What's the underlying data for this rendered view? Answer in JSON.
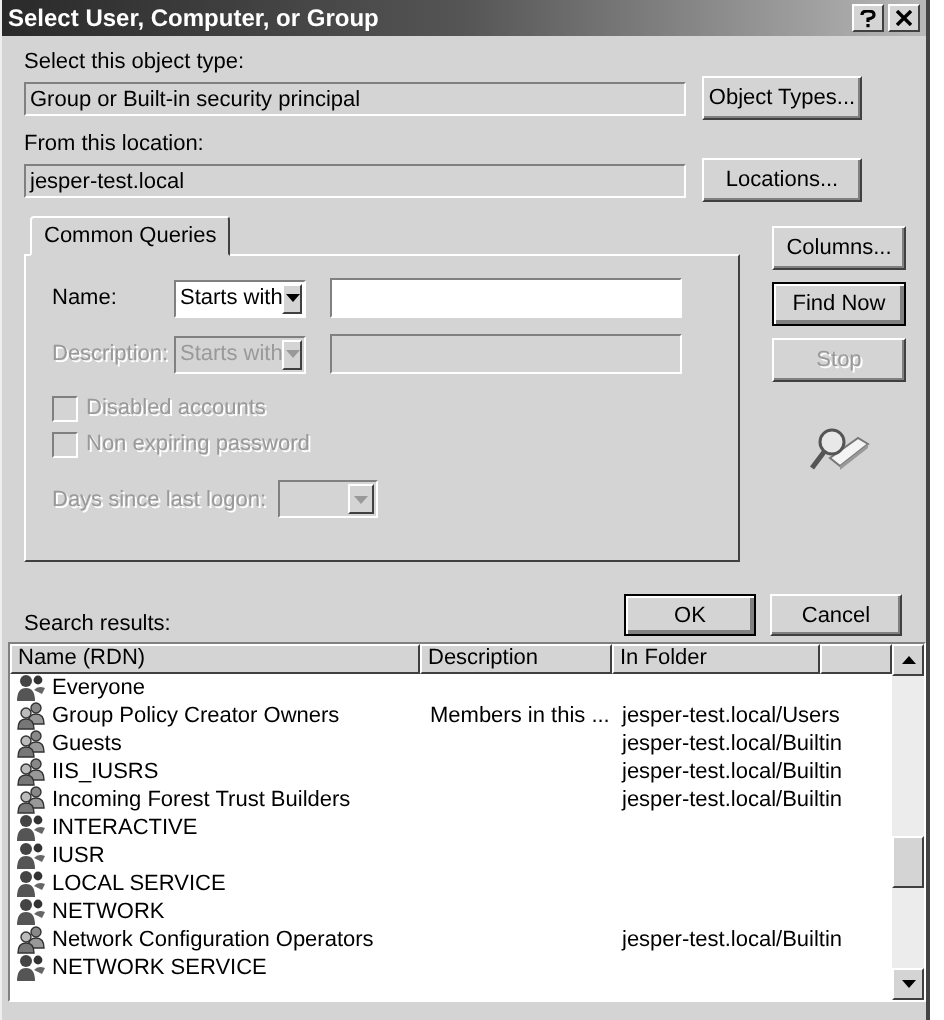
{
  "window": {
    "title": "Select User, Computer, or Group"
  },
  "object_type": {
    "label": "Select this object type:",
    "value": "Group or Built-in security principal",
    "button": "Object Types..."
  },
  "location": {
    "label": "From this location:",
    "value": "jesper-test.local",
    "button": "Locations..."
  },
  "tabs": [
    {
      "label": "Common Queries",
      "selected": true
    }
  ],
  "query": {
    "name": {
      "label": "Name:",
      "mode": "Starts with",
      "disabled": false
    },
    "description": {
      "label": "Description:",
      "mode": "Starts with",
      "disabled": true
    },
    "options": [
      {
        "label": "Disabled accounts",
        "checked": false,
        "disabled": true
      },
      {
        "label": "Non expiring password",
        "checked": false,
        "disabled": true
      }
    ],
    "days": {
      "label": "Days since last logon:",
      "disabled": true
    }
  },
  "side_buttons": [
    {
      "label": "Columns...",
      "disabled": false,
      "default": false
    },
    {
      "label": "Find Now",
      "disabled": false,
      "default": true
    },
    {
      "label": "Stop",
      "disabled": true,
      "default": false
    }
  ],
  "dialog_buttons": [
    "OK",
    "Cancel"
  ],
  "results": {
    "label": "Search results:",
    "columns": [
      "Name (RDN)",
      "Description",
      "In Folder"
    ],
    "rows": [
      {
        "kind": "special",
        "name": "Everyone"
      },
      {
        "kind": "group",
        "name": "Group Policy Creator Owners",
        "description": "Members in this ...",
        "folder": "jesper-test.local/Users"
      },
      {
        "kind": "group",
        "name": "Guests",
        "folder": "jesper-test.local/Builtin"
      },
      {
        "kind": "group",
        "name": "IIS_IUSRS",
        "folder": "jesper-test.local/Builtin"
      },
      {
        "kind": "group",
        "name": "Incoming Forest Trust Builders",
        "folder": "jesper-test.local/Builtin"
      },
      {
        "kind": "special",
        "name": "INTERACTIVE"
      },
      {
        "kind": "special",
        "name": "IUSR"
      },
      {
        "kind": "special",
        "name": "LOCAL SERVICE"
      },
      {
        "kind": "special",
        "name": "NETWORK"
      },
      {
        "kind": "group",
        "name": "Network Configuration Operators",
        "folder": "jesper-test.local/Builtin"
      },
      {
        "kind": "special",
        "name": "NETWORK SERVICE"
      }
    ]
  }
}
